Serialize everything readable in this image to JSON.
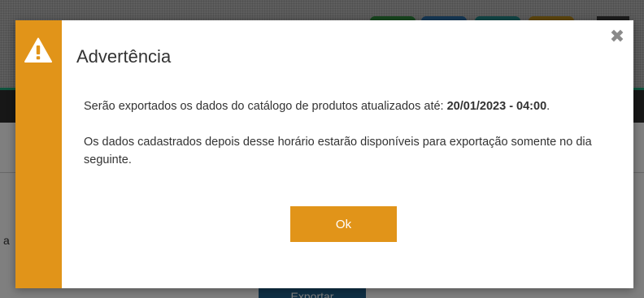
{
  "background": {
    "partial_text": "a",
    "export_button_label": "Exportar"
  },
  "modal": {
    "title": "Advertência",
    "icon": "warning-icon",
    "close_icon": "close-icon",
    "close_glyph": "✖",
    "paragraph1": {
      "text": "Serão exportados os dados do catálogo de produtos atualizados até: ",
      "date": "20/01/2023 - 04:00",
      "suffix": "."
    },
    "paragraph2": "Os dados cadastrados depois desse horário estarão disponíveis para exportação somente no dia seguinte.",
    "ok_label": "Ok"
  },
  "colors": {
    "accent": "#e19419",
    "overlay": "rgba(0,0,0,0.5)",
    "text": "#333333"
  }
}
